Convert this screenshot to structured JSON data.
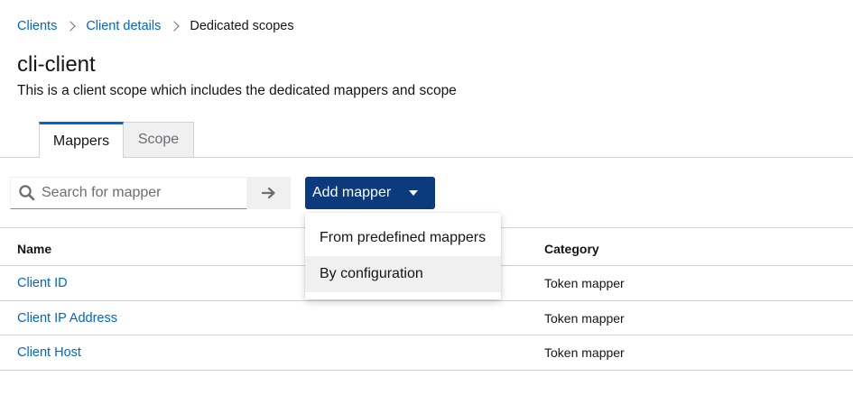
{
  "breadcrumb": {
    "items": [
      "Clients",
      "Client details",
      "Dedicated scopes"
    ]
  },
  "header": {
    "title": "cli-client",
    "description": "This is a client scope which includes the dedicated mappers and scope"
  },
  "tabs": [
    {
      "label": "Mappers",
      "active": true
    },
    {
      "label": "Scope",
      "active": false
    }
  ],
  "toolbar": {
    "search_placeholder": "Search for mapper",
    "search_value": "",
    "add_mapper_label": "Add mapper"
  },
  "dropdown": {
    "items": [
      "From predefined mappers",
      "By configuration"
    ],
    "highlighted_index": 1
  },
  "table": {
    "columns": [
      "Name",
      "Category"
    ],
    "rows": [
      {
        "name": "Client ID",
        "category": "Token mapper"
      },
      {
        "name": "Client IP Address",
        "category": "Token mapper"
      },
      {
        "name": "Client Host",
        "category": "Token mapper"
      }
    ]
  },
  "colors": {
    "link": "#0066cc",
    "primary_button": "#0b3a7d",
    "tab_active_border": "#0066cc",
    "border": "#d2d2d2",
    "menu_hover": "#f0f0f0"
  },
  "icons": {
    "search": "search-icon",
    "submit": "arrow-right-icon",
    "dropdown_caret": "caret-down-icon",
    "breadcrumb_separator": "chevron-right-icon"
  }
}
